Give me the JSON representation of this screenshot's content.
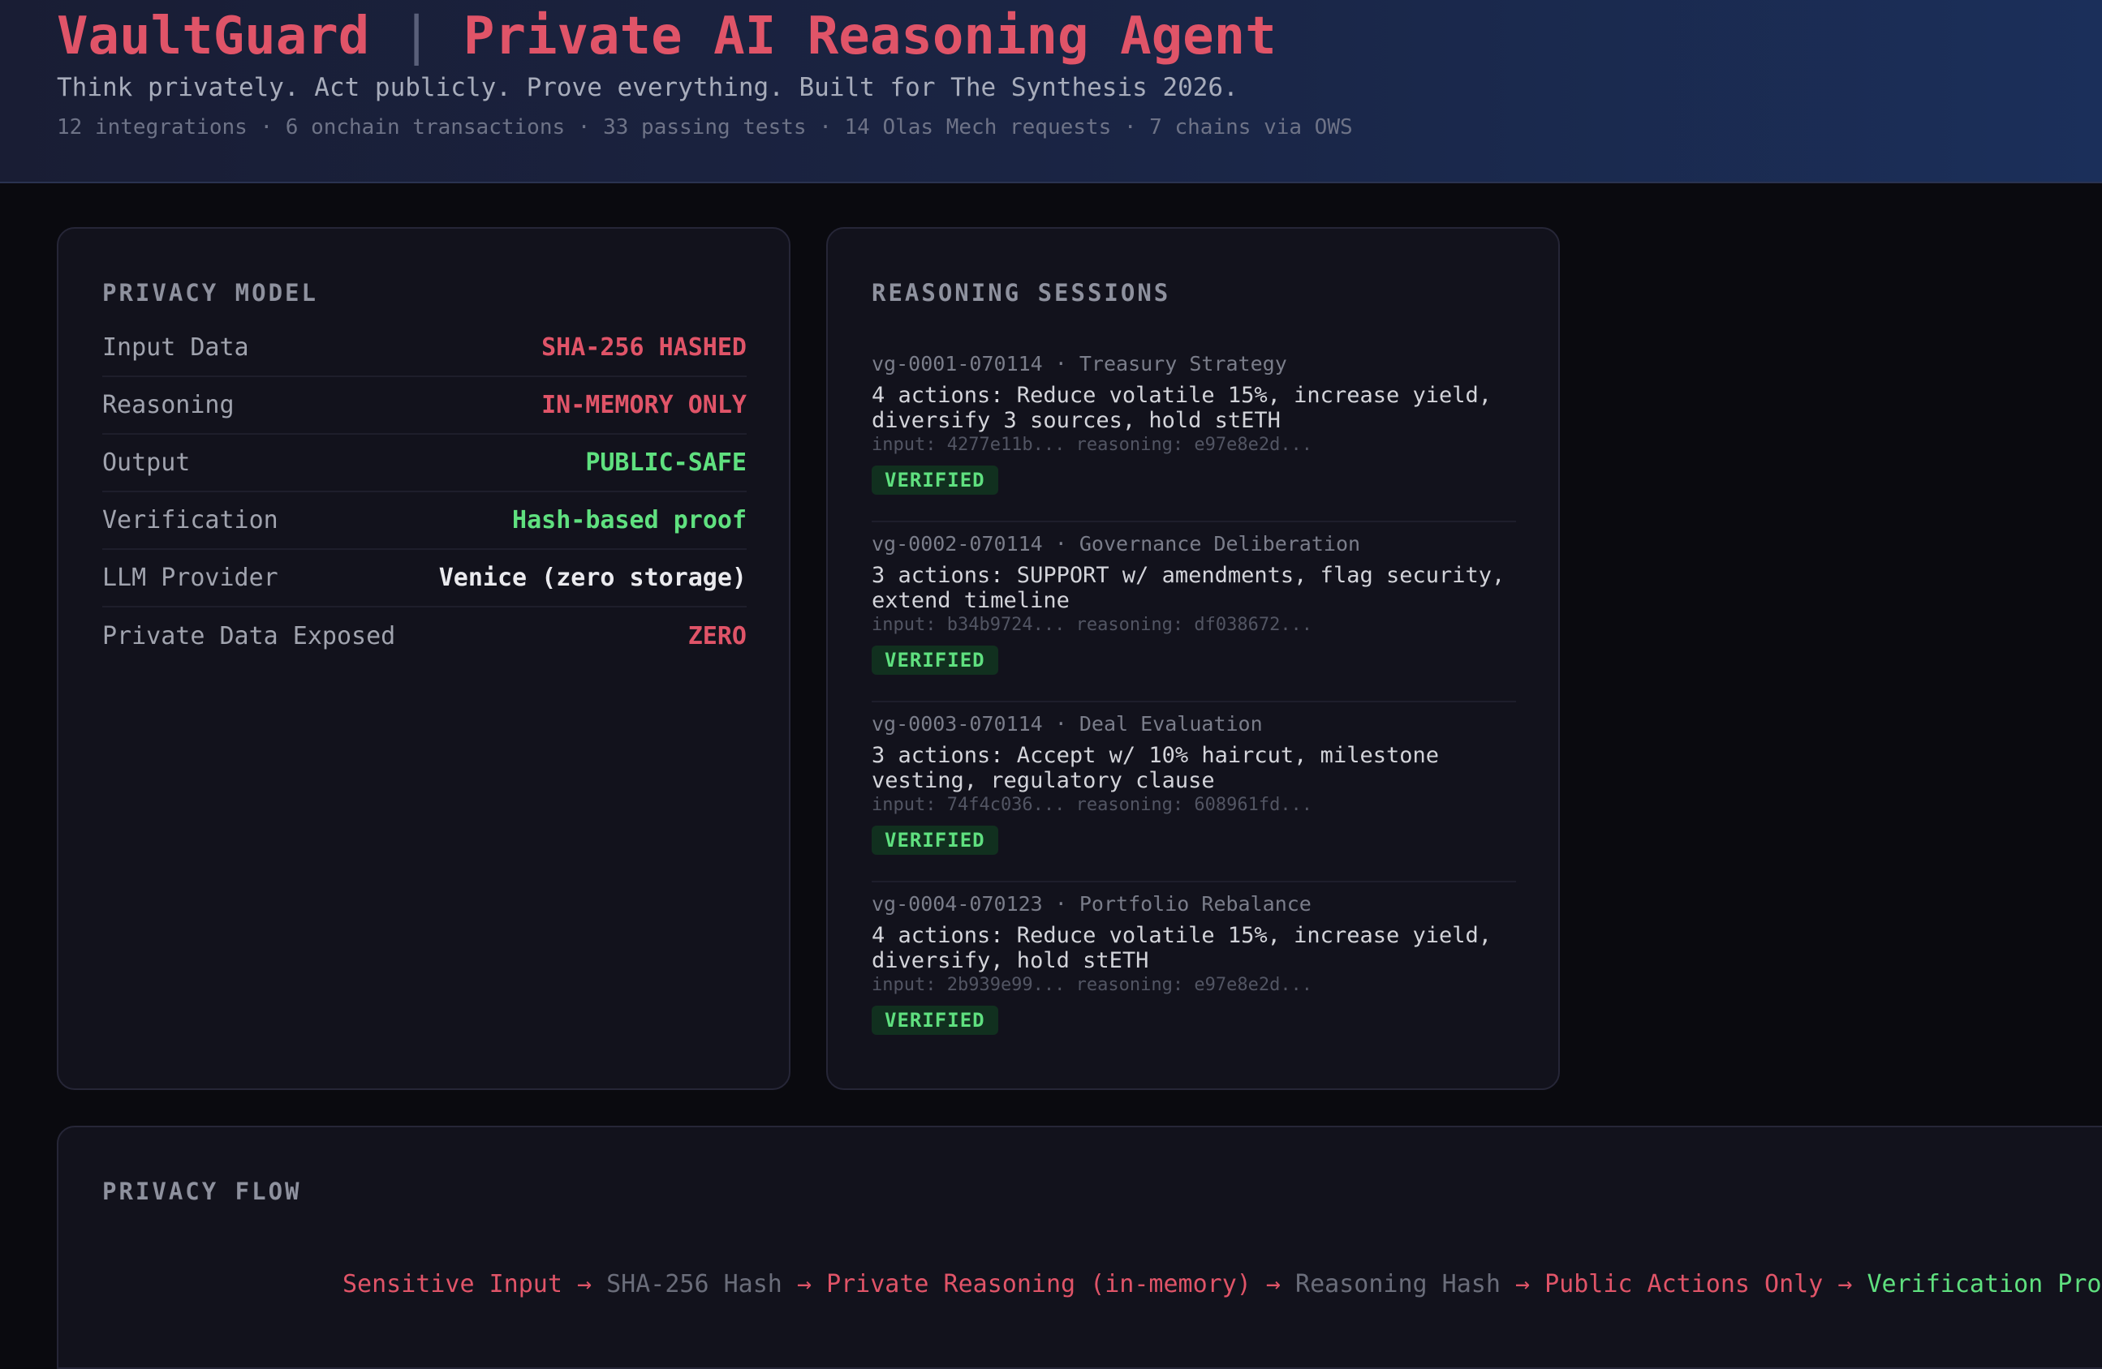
{
  "header": {
    "brand": "VaultGuard",
    "separator": "|",
    "title": "Private AI Reasoning Agent",
    "subtitle": "Think privately. Act publicly. Prove everything. Built for The Synthesis 2026.",
    "stats": "12 integrations · 6 onchain transactions · 33 passing tests · 14 Olas Mech requests · 7 chains via OWS"
  },
  "privacy_model": {
    "title": "PRIVACY MODEL",
    "rows": [
      {
        "label": "Input Data",
        "value": "SHA-256 HASHED",
        "color": "#e05468"
      },
      {
        "label": "Reasoning",
        "value": "IN-MEMORY ONLY",
        "color": "#e05468"
      },
      {
        "label": "Output",
        "value": "PUBLIC-SAFE",
        "color": "#5fe07f"
      },
      {
        "label": "Verification",
        "value": "Hash-based proof",
        "color": "#5fe07f"
      },
      {
        "label": "LLM Provider",
        "value": "Venice (zero storage)",
        "color": "#eaeaee"
      },
      {
        "label": "Private Data Exposed",
        "value": "ZERO",
        "color": "#e05468"
      }
    ]
  },
  "reasoning_sessions": {
    "title": "REASONING SESSIONS",
    "sessions": [
      {
        "id": "vg-0001-070114",
        "name": "Treasury Strategy",
        "summary": "4 actions: Reduce volatile 15%, increase yield, diversify 3 sources, hold stETH",
        "hashes": "input: 4277e11b... reasoning: e97e8e2d...",
        "status": "VERIFIED"
      },
      {
        "id": "vg-0002-070114",
        "name": "Governance Deliberation",
        "summary": "3 actions: SUPPORT w/ amendments, flag security, extend timeline",
        "hashes": "input: b34b9724... reasoning: df038672...",
        "status": "VERIFIED"
      },
      {
        "id": "vg-0003-070114",
        "name": "Deal Evaluation",
        "summary": "3 actions: Accept w/ 10% haircut, milestone vesting, regulatory clause",
        "hashes": "input: 74f4c036... reasoning: 608961fd...",
        "status": "VERIFIED"
      },
      {
        "id": "vg-0004-070123",
        "name": "Portfolio Rebalance",
        "summary": "4 actions: Reduce volatile 15%, increase yield, diversify, hold stETH",
        "hashes": "input: 2b939e99... reasoning: e97e8e2d...",
        "status": "VERIFIED"
      }
    ]
  },
  "privacy_flow": {
    "title": "PRIVACY FLOW",
    "arrow": "→",
    "steps": [
      {
        "label": "Sensitive Input",
        "color": "#e05468"
      },
      {
        "label": "SHA-256 Hash",
        "color": "#6a6d7a"
      },
      {
        "label": "Private Reasoning (in-memory)",
        "color": "#e05468"
      },
      {
        "label": "Reasoning Hash",
        "color": "#6a6d7a"
      },
      {
        "label": "Public Actions Only",
        "color": "#e05468"
      },
      {
        "label": "Verification Proof",
        "color": "#5fe07f"
      }
    ]
  }
}
